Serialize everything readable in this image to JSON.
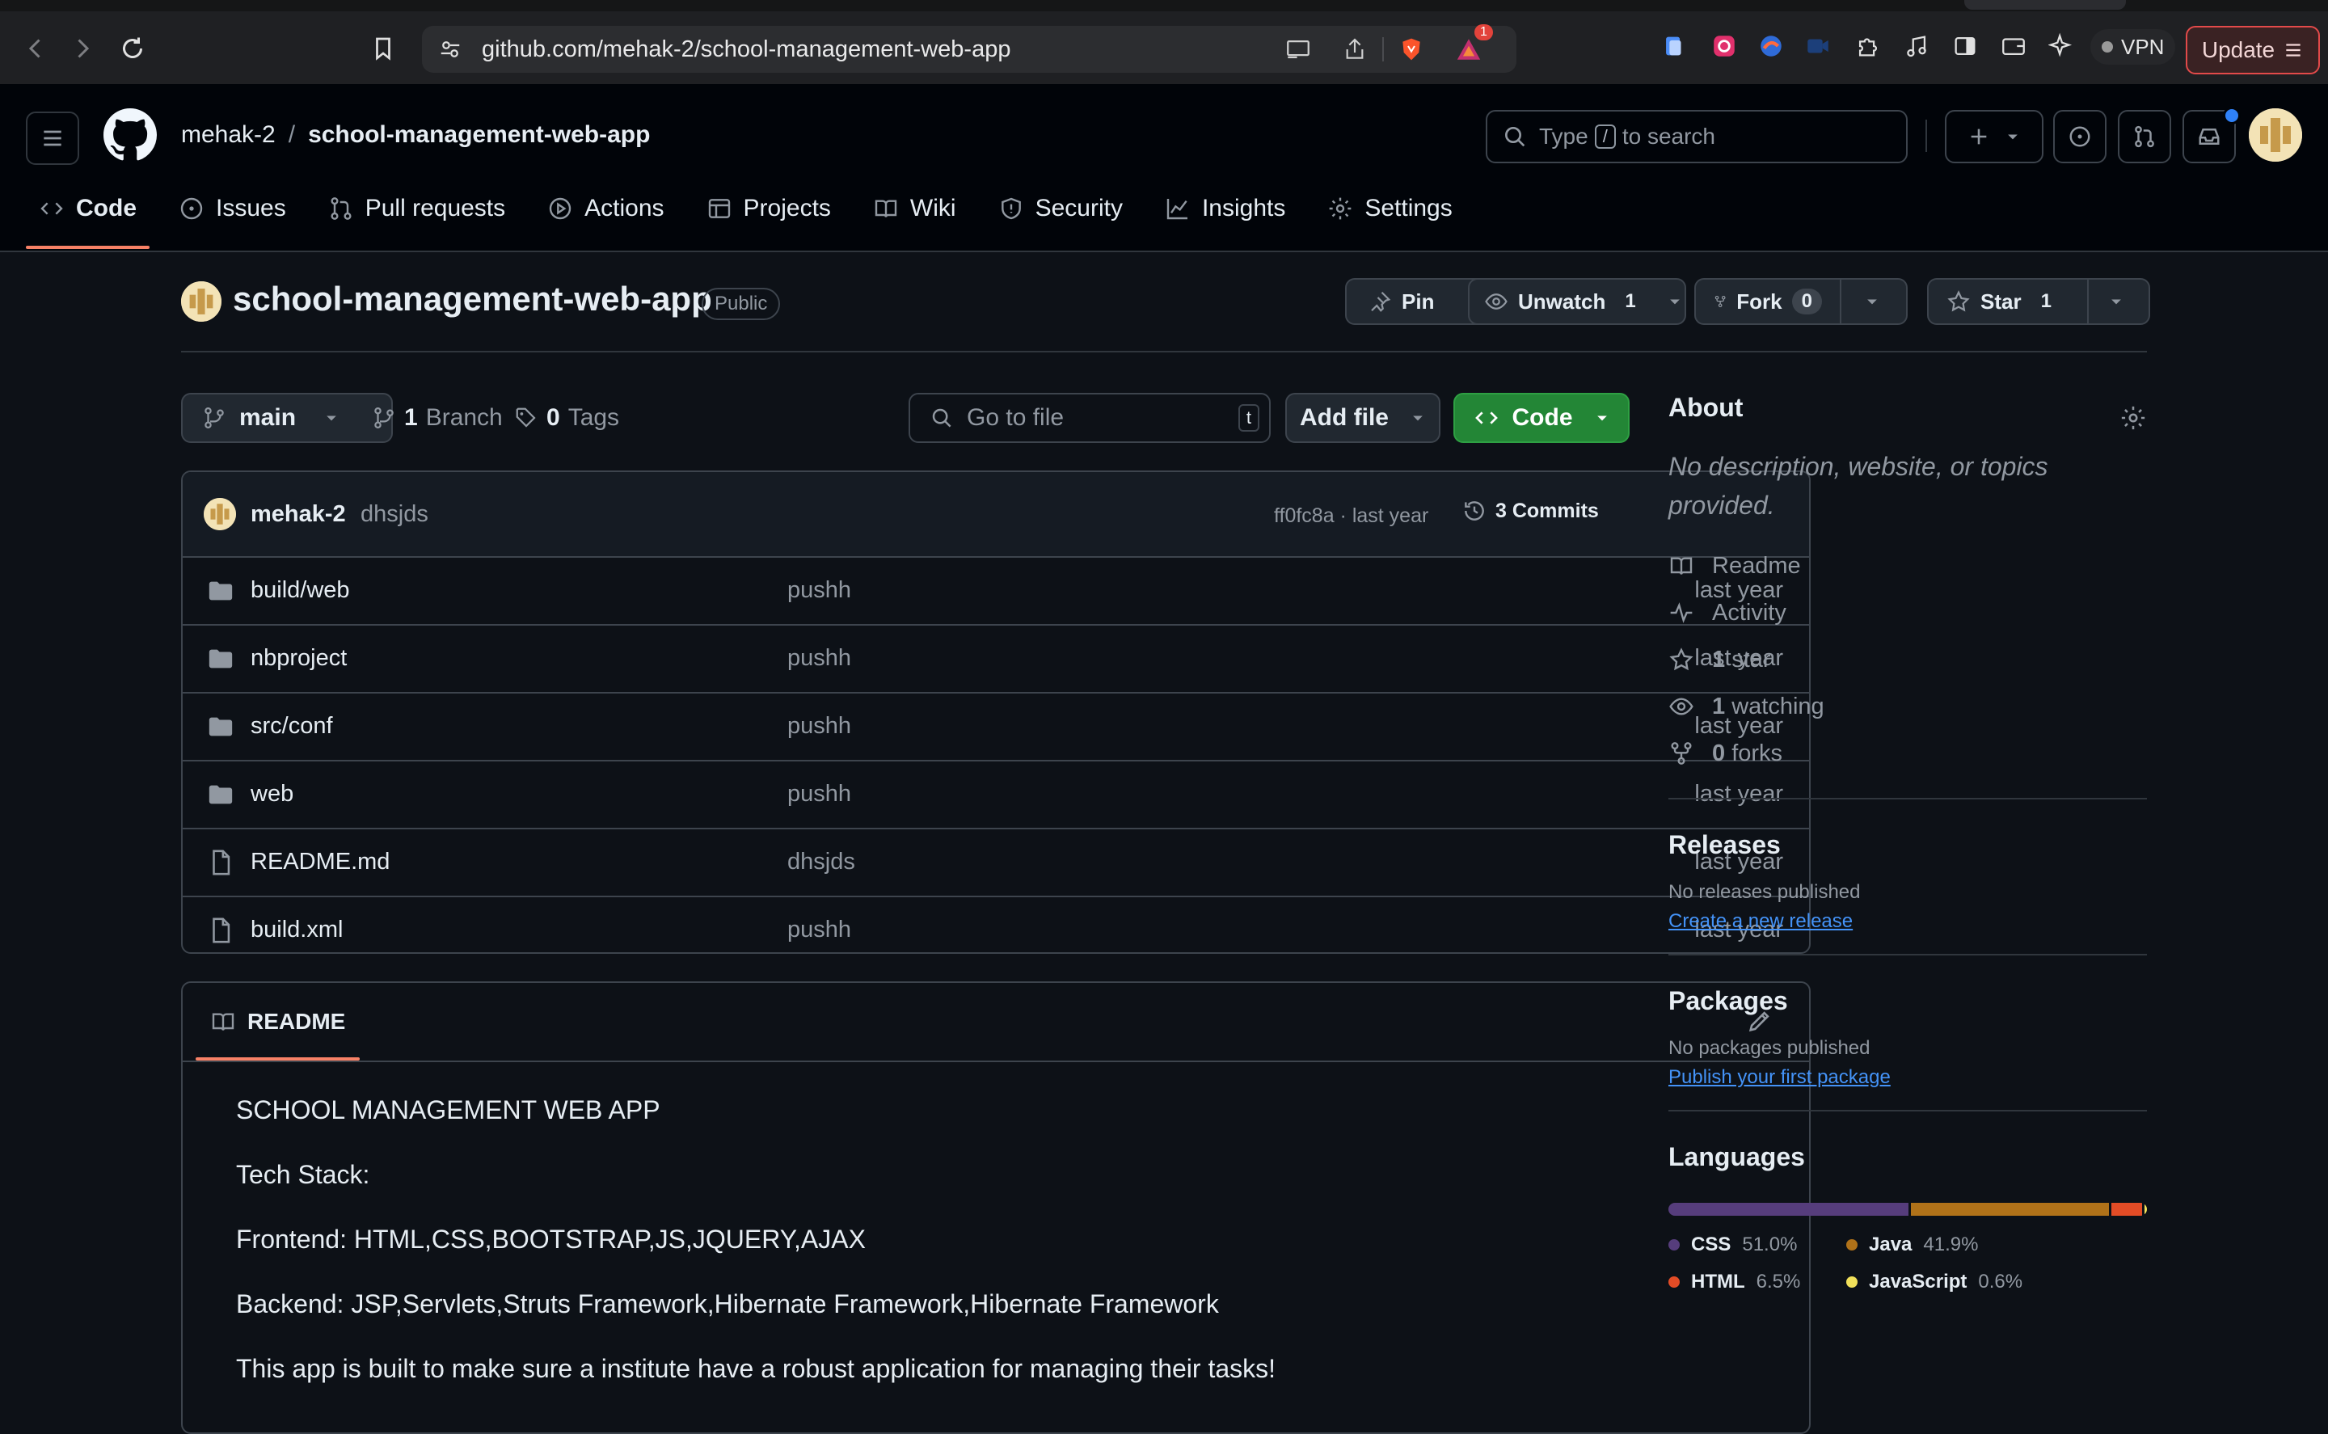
{
  "browser": {
    "url": "github.com/mehak-2/school-management-web-app",
    "notification_count": "1",
    "vpn_label": "VPN",
    "update_label": "Update"
  },
  "header": {
    "owner": "mehak-2",
    "separator": "/",
    "repo": "school-management-web-app",
    "search_prefix": "Type",
    "search_key": "/",
    "search_suffix": "to search"
  },
  "repo_nav": [
    {
      "label": "Code",
      "icon": "code-icon"
    },
    {
      "label": "Issues",
      "icon": "issue-icon"
    },
    {
      "label": "Pull requests",
      "icon": "pull-request-icon"
    },
    {
      "label": "Actions",
      "icon": "play-icon"
    },
    {
      "label": "Projects",
      "icon": "table-icon"
    },
    {
      "label": "Wiki",
      "icon": "book-icon"
    },
    {
      "label": "Security",
      "icon": "shield-icon"
    },
    {
      "label": "Insights",
      "icon": "graph-icon"
    },
    {
      "label": "Settings",
      "icon": "gear-icon"
    }
  ],
  "repo": {
    "name": "school-management-web-app",
    "visibility": "Public",
    "pin_label": "Pin",
    "unwatch_label": "Unwatch",
    "watch_count": "1",
    "fork_label": "Fork",
    "fork_count": "0",
    "star_label": "Star",
    "star_count": "1"
  },
  "toolbar": {
    "branch": "main",
    "branch_count": "1",
    "branch_label": "Branch",
    "tag_count": "0",
    "tag_label": "Tags",
    "goto_placeholder": "Go to file",
    "goto_key": "t",
    "add_file_label": "Add file",
    "code_label": "Code"
  },
  "latest_commit": {
    "author": "mehak-2",
    "message": "dhsjds",
    "hash_time": "ff0fc8a · last year",
    "commits_label": "3 Commits"
  },
  "files": [
    {
      "name": "build/web",
      "type": "folder",
      "message": "pushh",
      "date": "last year"
    },
    {
      "name": "nbproject",
      "type": "folder",
      "message": "pushh",
      "date": "last year"
    },
    {
      "name": "src/conf",
      "type": "folder",
      "message": "pushh",
      "date": "last year"
    },
    {
      "name": "web",
      "type": "folder",
      "message": "pushh",
      "date": "last year"
    },
    {
      "name": "README.md",
      "type": "file",
      "message": "dhsjds",
      "date": "last year"
    },
    {
      "name": "build.xml",
      "type": "file",
      "message": "pushh",
      "date": "last year"
    }
  ],
  "readme": {
    "tab_label": "README",
    "paragraphs": [
      "SCHOOL MANAGEMENT WEB APP",
      "Tech Stack:",
      "Frontend: HTML,CSS,BOOTSTRAP,JS,JQUERY,AJAX",
      "Backend: JSP,Servlets,Struts Framework,Hibernate Framework,Hibernate Framework",
      "This app is built to make sure a institute have a robust application for managing their tasks!"
    ]
  },
  "about": {
    "title": "About",
    "description": "No description, website, or topics provided.",
    "items": [
      {
        "icon": "book-icon",
        "count": "",
        "label": "Readme"
      },
      {
        "icon": "pulse-icon",
        "count": "",
        "label": "Activity"
      },
      {
        "icon": "star-icon",
        "count": "1",
        "label": "star"
      },
      {
        "icon": "eye-icon",
        "count": "1",
        "label": "watching"
      },
      {
        "icon": "fork-icon",
        "count": "0",
        "label": "forks"
      }
    ]
  },
  "releases": {
    "title": "Releases",
    "empty_text": "No releases published",
    "link": "Create a new release"
  },
  "packages": {
    "title": "Packages",
    "empty_text": "No packages published",
    "link": "Publish your first package"
  },
  "languages": {
    "title": "Languages",
    "items": [
      {
        "name": "CSS",
        "percent": "51.0%",
        "value": 51.0,
        "color": "#563d7c"
      },
      {
        "name": "Java",
        "percent": "41.9%",
        "value": 41.9,
        "color": "#b07219"
      },
      {
        "name": "HTML",
        "percent": "6.5%",
        "value": 6.5,
        "color": "#e34c26"
      },
      {
        "name": "JavaScript",
        "percent": "0.6%",
        "value": 0.6,
        "color": "#f1e05a"
      }
    ]
  }
}
